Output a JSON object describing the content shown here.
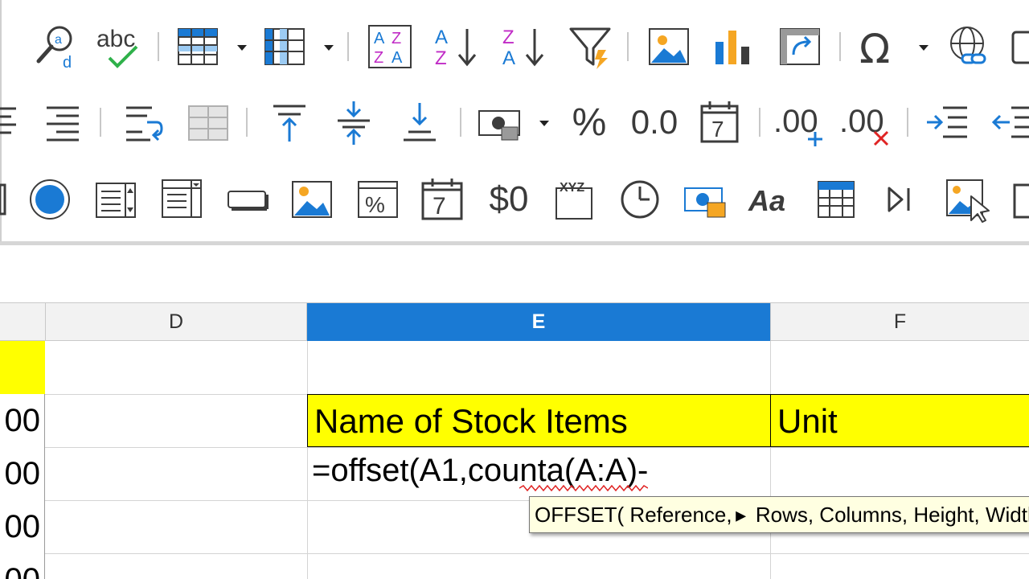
{
  "toolbar": {
    "row1": {
      "spelling_text": "abc",
      "sort_ascending_letters": [
        "A",
        "Z"
      ],
      "sort_descending_letters": [
        "Z",
        "A"
      ],
      "sort_grid_letters": [
        "A",
        "Z",
        "Z",
        "A"
      ]
    },
    "row2": {
      "percent_label": "%",
      "number_label": "0.0",
      "date_label": "7",
      "add_decimal_label": ".00",
      "delete_decimal_label": ".00"
    },
    "row3": {
      "date_field_label": "7",
      "currency_field_label": "$0",
      "pattern_field_label": "XYZ",
      "fontwork_label": "Aa"
    }
  },
  "sheet": {
    "columns": [
      {
        "label": "D",
        "active": false
      },
      {
        "label": "E",
        "active": true
      },
      {
        "label": "F",
        "active": false
      }
    ],
    "left_partial_cells": [
      "",
      "00",
      "00",
      "00",
      "00"
    ],
    "cells": {
      "e2": "Name of Stock Items",
      "f2": "Unit"
    },
    "formula_input": "=offset(A1,counta(A:A)-",
    "tooltip": {
      "function": "OFFSET( Reference,",
      "rest": " Rows, Columns, Height, Width"
    }
  },
  "colors": {
    "accent": "#1a7ad4",
    "highlight": "#ffff00",
    "tooltip_bg": "#ffffe1"
  }
}
